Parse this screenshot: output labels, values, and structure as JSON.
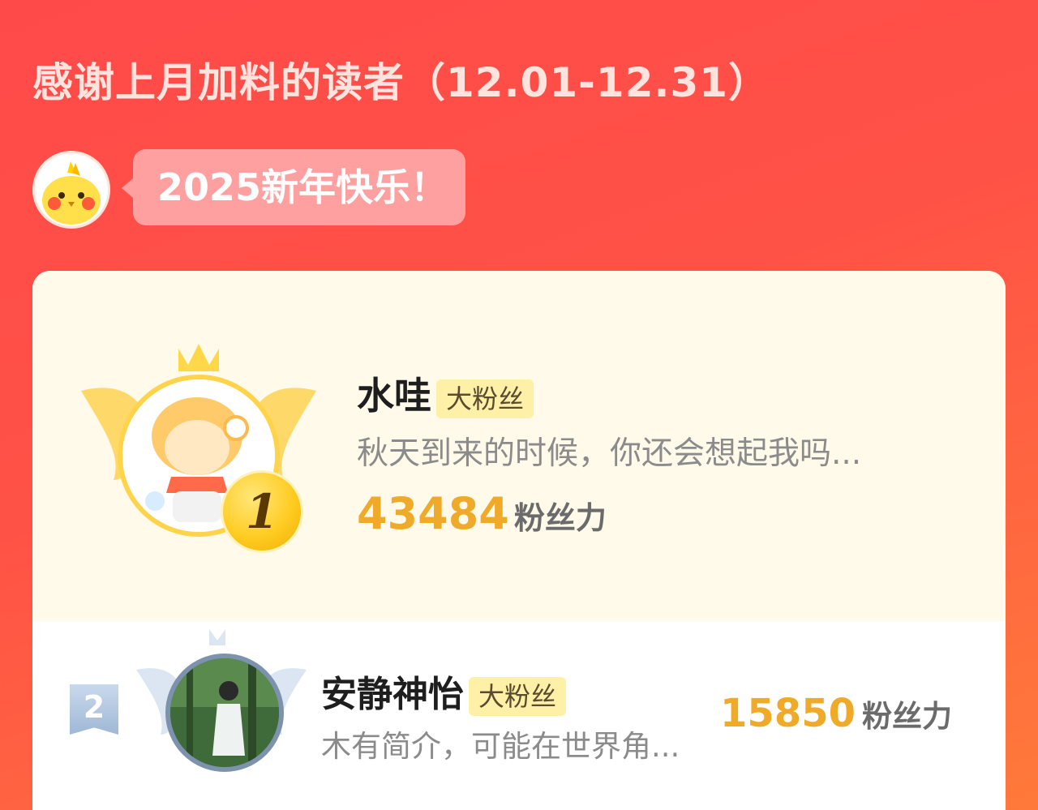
{
  "header": {
    "title": "感谢上月加料的读者（12.01-12.31）"
  },
  "greeting": {
    "message": "2025新年快乐！",
    "mascot_icon": "chick-mascot-icon"
  },
  "colors": {
    "background_start": "#ff4a4a",
    "background_end": "#ff7a3a",
    "score": "#f0aa2a",
    "gold": "#ffcc23",
    "silver": "#9fb8d6"
  },
  "ranking": [
    {
      "rank": "1",
      "name": "水哇",
      "tag": "大粉丝",
      "bio": "秋天到来的时候，你还会想起我吗...",
      "score": "43484",
      "score_unit": "粉丝力"
    },
    {
      "rank": "2",
      "name": "安静神怡",
      "tag": "大粉丝",
      "bio": "木有简介，可能在世界角...",
      "score": "15850",
      "score_unit": "粉丝力"
    }
  ]
}
